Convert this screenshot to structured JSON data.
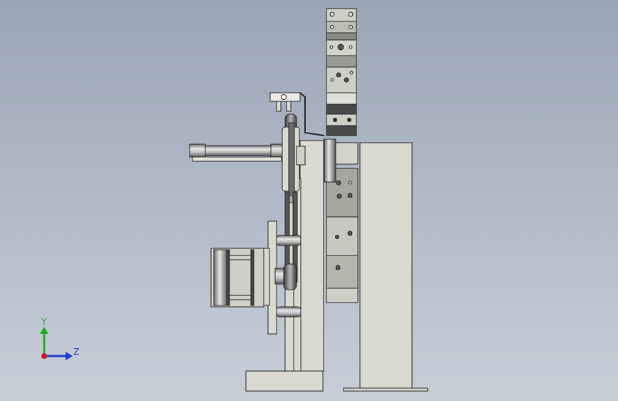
{
  "viewport": {
    "background_top": "#9aa5b6",
    "background_bottom": "#c8ced8",
    "part_fill": "#d9d9cf",
    "part_edge": "#2b2b2b",
    "dark_fill": "#3f3f3f"
  },
  "triad": {
    "y_label": "Y",
    "z_label": "Z",
    "y_color": "#22aa22",
    "z_color": "#1f3fd0",
    "origin_color": "#d01818"
  }
}
